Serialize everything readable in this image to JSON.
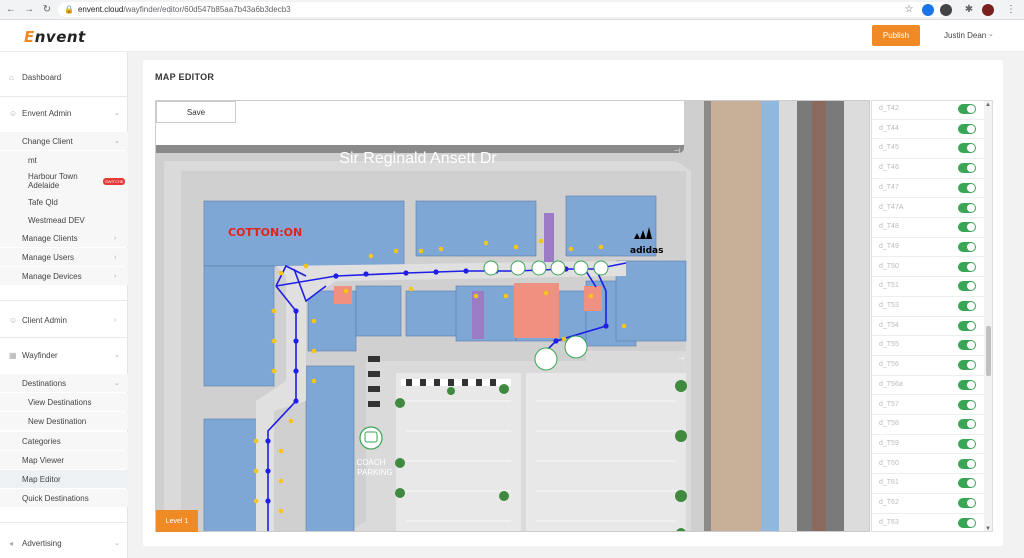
{
  "browser": {
    "url_host": "envent.cloud",
    "url_path": "/wayfinder/editor/60d547b85aa7b43a6b3decb3"
  },
  "header": {
    "logo": "Envent",
    "publish_label": "Publish",
    "user_name": "Justin Dean"
  },
  "sidebar": {
    "dashboard": "Dashboard",
    "envent_admin": "Envent Admin",
    "change_client": "Change Client",
    "clients": [
      "mt",
      "Harbour Town Adelaide",
      "Tafe Qld",
      "Westmead DEV"
    ],
    "current_badge": "SWITCHE",
    "manage_clients": "Manage Clients",
    "manage_users": "Manage Users",
    "manage_devices": "Manage Devices",
    "client_admin": "Client Admin",
    "wayfinder": "Wayfinder",
    "destinations": "Destinations",
    "view_destinations": "View Destinations",
    "new_destination": "New Destination",
    "categories": "Categories",
    "map_viewer": "Map Viewer",
    "map_editor": "Map Editor",
    "quick_destinations": "Quick Destinations",
    "advertising": "Advertising"
  },
  "page": {
    "title": "MAP EDITOR",
    "save_label": "Save",
    "level_label": "Level 1"
  },
  "map": {
    "street_name": "Sir Reginald Ansett Dr",
    "store_cotton": "COTTON:ON",
    "store_adidas": "adidas",
    "coach_label_1": "COACH",
    "coach_label_2": "PARKING",
    "colors": {
      "building": "#7fa7d6",
      "kiosk": "#f09080",
      "purple": "#9b7cc4",
      "path": "#1e1ee6",
      "node": "#f5c518",
      "road": "#7a7a7a",
      "parking_strip": "#c8b098"
    }
  },
  "destinations_list": [
    "d_T42",
    "d_T44",
    "d_T45",
    "d_T46",
    "d_T47",
    "d_T47A",
    "d_T48",
    "d_T49",
    "d_T50",
    "d_T51",
    "d_T53",
    "d_T54",
    "d_T55",
    "d_T56",
    "d_T56a",
    "d_T57",
    "d_T58",
    "d_T59",
    "d_T60",
    "d_T61",
    "d_T62",
    "d_T63"
  ]
}
